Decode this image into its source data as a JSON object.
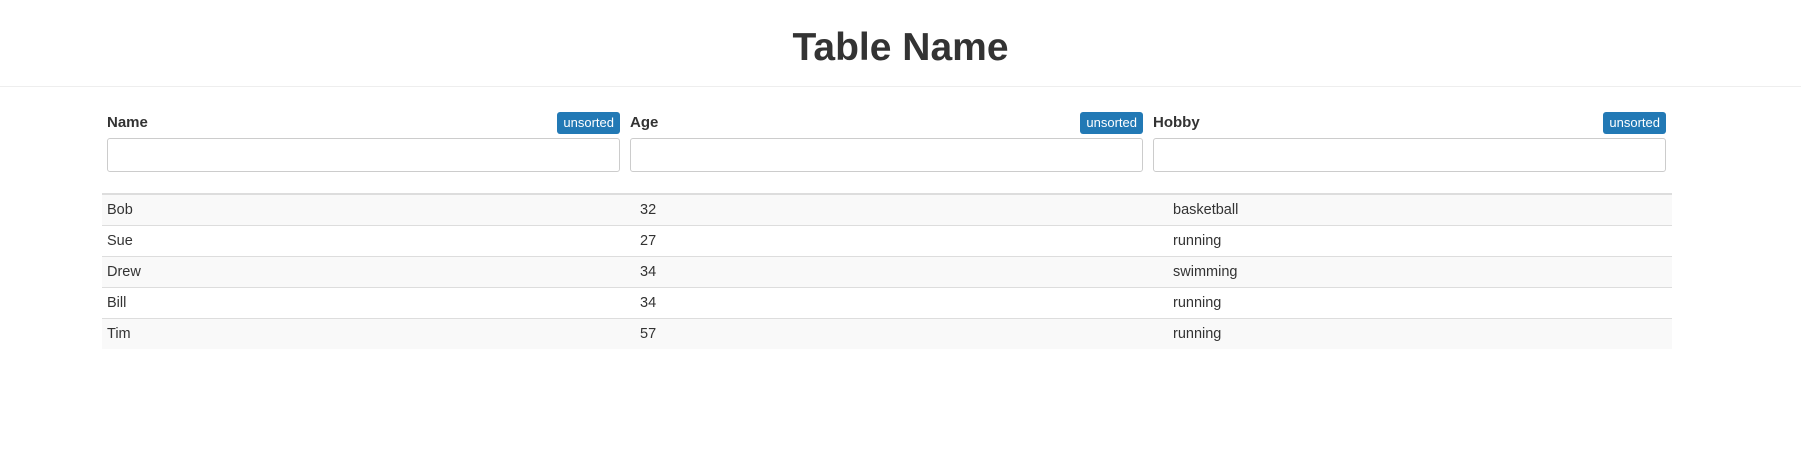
{
  "page": {
    "title": "Table Name"
  },
  "columns": [
    {
      "label": "Name",
      "sort_label": "unsorted",
      "filter_value": "",
      "filter_placeholder": ""
    },
    {
      "label": "Age",
      "sort_label": "unsorted",
      "filter_value": "",
      "filter_placeholder": ""
    },
    {
      "label": "Hobby",
      "sort_label": "unsorted",
      "filter_value": "",
      "filter_placeholder": ""
    }
  ],
  "rows": [
    {
      "name": "Bob",
      "age": "32",
      "hobby": "basketball"
    },
    {
      "name": "Sue",
      "age": "27",
      "hobby": "running"
    },
    {
      "name": "Drew",
      "age": "34",
      "hobby": "swimming"
    },
    {
      "name": "Bill",
      "age": "34",
      "hobby": "running"
    },
    {
      "name": "Tim",
      "age": "57",
      "hobby": "running"
    }
  ],
  "colors": {
    "badge": "#2279b5",
    "stripe": "#f9f9f9",
    "text": "#333333"
  }
}
